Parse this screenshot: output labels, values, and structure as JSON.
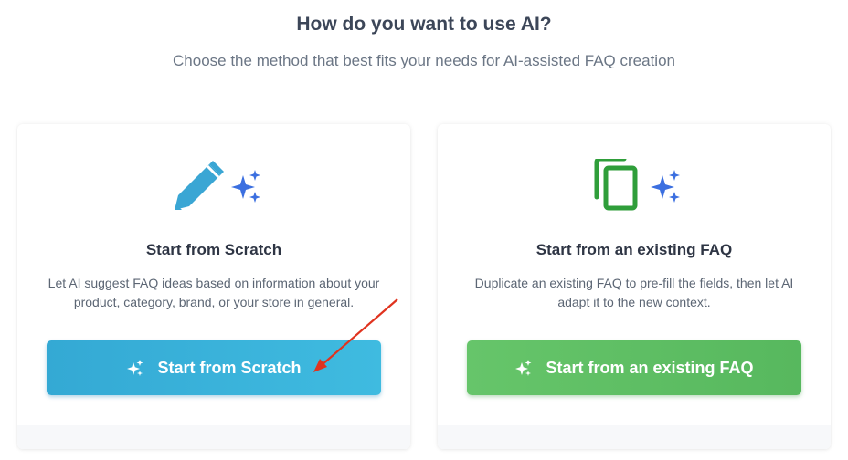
{
  "header": {
    "title": "How do you want to use AI?",
    "subtitle": "Choose the method that best fits your needs for AI-assisted FAQ creation"
  },
  "cards": [
    {
      "icon": "pencil-icon",
      "title": "Start from Scratch",
      "description": "Let AI suggest FAQ ideas based on information about your product, category, brand, or your store in general.",
      "button_label": "Start from Scratch",
      "button_color": "#3bb4dc"
    },
    {
      "icon": "copy-icon",
      "title": "Start from an existing FAQ",
      "description": "Duplicate an existing FAQ to pre-fill the fields, then let AI adapt it to the new context.",
      "button_label": "Start from an existing FAQ",
      "button_color": "#5fbf65"
    }
  ],
  "colors": {
    "sparkle": "#3b6fe0",
    "pencil": "#3aa6d4",
    "copy": "#2f9e3a",
    "annotation_arrow": "#e0331f"
  }
}
